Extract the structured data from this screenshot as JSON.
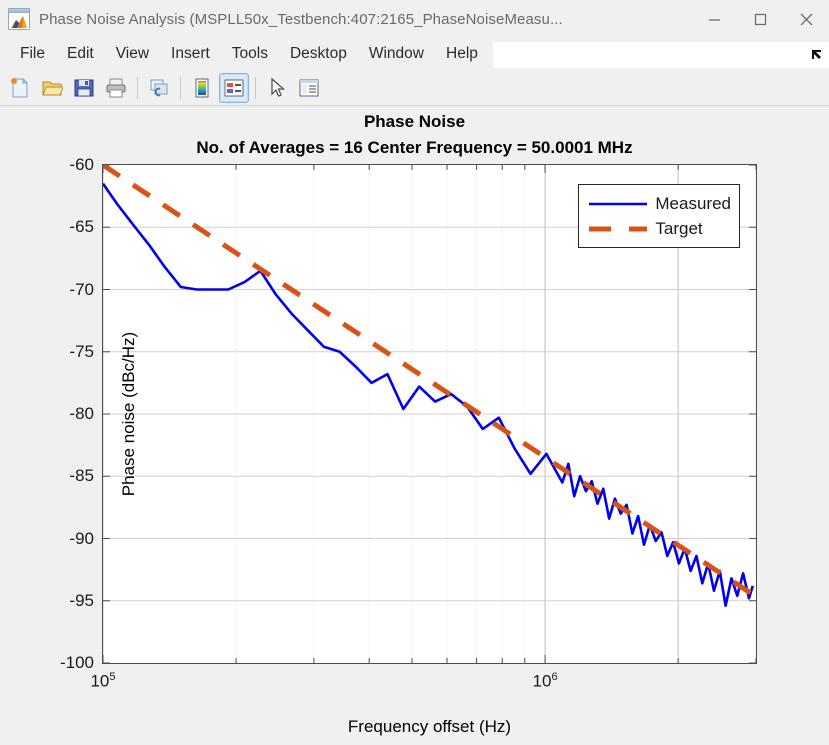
{
  "window": {
    "title": "Phase Noise Analysis (MSPLL50x_Testbench:407:2165_PhaseNoiseMeasu...",
    "app_icon": "matlab-membrane-icon",
    "minimize_label": "—",
    "maximize_label": "□",
    "close_label": "✕"
  },
  "menubar": {
    "items": [
      {
        "label": "File"
      },
      {
        "label": "Edit"
      },
      {
        "label": "View"
      },
      {
        "label": "Insert"
      },
      {
        "label": "Tools"
      },
      {
        "label": "Desktop"
      },
      {
        "label": "Window"
      },
      {
        "label": "Help"
      }
    ],
    "dock_icon": "dock-arrow-icon"
  },
  "toolbar": {
    "buttons": [
      {
        "name": "new-figure-button",
        "icon": "new-document-icon",
        "active": false
      },
      {
        "name": "open-file-button",
        "icon": "open-folder-icon",
        "active": false
      },
      {
        "name": "save-figure-button",
        "icon": "floppy-save-icon",
        "active": false
      },
      {
        "name": "print-figure-button",
        "icon": "printer-icon",
        "active": false
      },
      {
        "name": "link-plot-button",
        "icon": "link-plot-icon",
        "active": false
      },
      {
        "name": "insert-colorbar-button",
        "icon": "colorbar-icon",
        "active": false
      },
      {
        "name": "insert-legend-button",
        "icon": "legend-icon",
        "active": true
      },
      {
        "name": "edit-plot-button",
        "icon": "pointer-arrow-icon",
        "active": false
      },
      {
        "name": "property-editor-button",
        "icon": "property-editor-icon",
        "active": false
      }
    ]
  },
  "chart_data": {
    "type": "line",
    "title": "Phase Noise",
    "subtitle": "No. of Averages = 16 Center Frequency = 50.0001 MHz",
    "xlabel": "Frequency offset (Hz)",
    "ylabel": "Phase noise (dBc/Hz)",
    "xscale": "log",
    "xlim": [
      100000,
      3000000
    ],
    "ylim": [
      -100,
      -60
    ],
    "ytick_labels": [
      "-60",
      "-65",
      "-70",
      "-75",
      "-80",
      "-85",
      "-90",
      "-95",
      "-100"
    ],
    "ytick_values": [
      -60,
      -65,
      -70,
      -75,
      -80,
      -85,
      -90,
      -95,
      -100
    ],
    "xtick_labels": [
      "10^5",
      "10^6"
    ],
    "xtick_values": [
      100000,
      1000000
    ],
    "grid": true,
    "legend_position": "top-right",
    "series": [
      {
        "name": "Measured",
        "color": "#0000f0",
        "style": "solid",
        "width": 2.6,
        "x": [
          100000,
          108000,
          117000,
          127000,
          138000,
          150000,
          163000,
          177000,
          192000,
          209000,
          227000,
          246000,
          268000,
          291000,
          316000,
          343000,
          373000,
          405000,
          440000,
          478000,
          519000,
          564000,
          613000,
          666000,
          723000,
          786000,
          854000,
          927000,
          1007000,
          1094000,
          1129000,
          1164000,
          1200000,
          1237000,
          1275000,
          1314000,
          1354000,
          1396000,
          1439000,
          1483000,
          1529000,
          1576000,
          1624000,
          1674000,
          1726000,
          1779000,
          1834000,
          1890000,
          1948000,
          2008000,
          2070000,
          2134000,
          2200000,
          2268000,
          2338000,
          2410000,
          2484000,
          2561000,
          2640000,
          2721000,
          2805000,
          2892000,
          2950000
        ],
        "y": [
          -61.5,
          -63.2,
          -64.8,
          -66.4,
          -68.2,
          -69.8,
          -70.0,
          -70.0,
          -70.0,
          -69.4,
          -68.5,
          -70.4,
          -72.0,
          -73.3,
          -74.6,
          -75.0,
          -76.2,
          -77.5,
          -76.8,
          -79.6,
          -77.8,
          -79.0,
          -78.4,
          -79.4,
          -81.2,
          -80.3,
          -82.8,
          -84.8,
          -83.2,
          -85.5,
          -84.0,
          -86.6,
          -85.0,
          -86.2,
          -85.4,
          -87.2,
          -86.0,
          -88.4,
          -86.8,
          -88.0,
          -87.3,
          -89.6,
          -88.2,
          -90.5,
          -88.9,
          -90.2,
          -89.5,
          -91.4,
          -90.3,
          -92.0,
          -90.8,
          -92.6,
          -91.4,
          -93.6,
          -92.0,
          -94.2,
          -92.6,
          -95.4,
          -93.2,
          -94.6,
          -92.8,
          -94.8,
          -93.8
        ]
      },
      {
        "name": "Target",
        "color": "#d95319",
        "style": "dashed",
        "width": 5,
        "x": [
          100000,
          2950000
        ],
        "y": [
          -60.0,
          -94.5
        ]
      }
    ]
  }
}
